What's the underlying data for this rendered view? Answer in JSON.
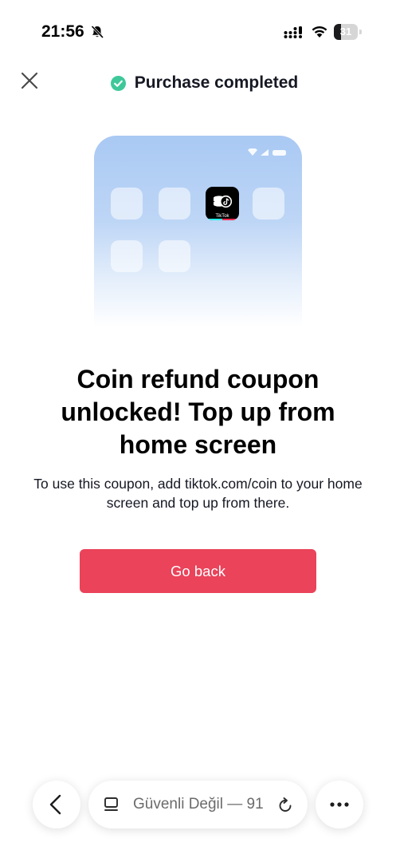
{
  "status_bar": {
    "time": "21:56",
    "battery_level": "31",
    "battery_fraction": 0.31
  },
  "header": {
    "title": "Purchase completed",
    "close_icon": "close-icon",
    "check_icon": "check-circle-icon",
    "check_color": "#3ec89a"
  },
  "illustration": {
    "app_label": "TikTok"
  },
  "main": {
    "headline": "Coin refund coupon unlocked! Top up from home screen",
    "description": "To use this coupon, add tiktok.com/coin to your home screen and top up from there.",
    "button_label": "Go back",
    "button_color": "#ea435a"
  },
  "browser_bar": {
    "back_icon": "chevron-left-icon",
    "tabs_icon": "tabs-icon",
    "address": "Güvenli Değil — 91",
    "reload_icon": "reload-icon",
    "more_icon": "more-dots-icon"
  }
}
